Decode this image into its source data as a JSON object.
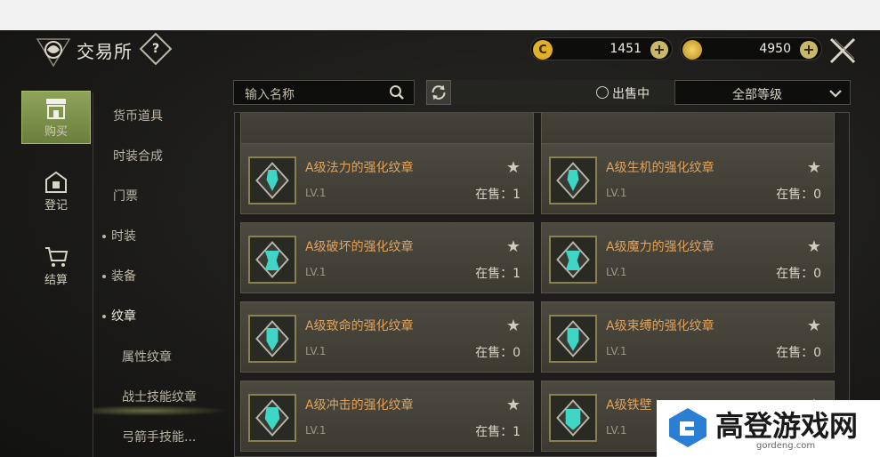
{
  "header": {
    "title": "交易所",
    "help": "?",
    "currencies": [
      {
        "icon": "c-coin-icon",
        "value": "1451"
      },
      {
        "icon": "gold-coin-icon",
        "value": "4950"
      }
    ],
    "plus": "+"
  },
  "leftnav": [
    {
      "label": "购买",
      "icon": "shop-icon",
      "active": true
    },
    {
      "label": "登记",
      "icon": "register-icon",
      "active": false
    },
    {
      "label": "结算",
      "icon": "cart-icon",
      "active": false
    }
  ],
  "sidenav": [
    {
      "label": "货币道具",
      "dot": false,
      "indent": false
    },
    {
      "label": "时装合成",
      "dot": false,
      "indent": false
    },
    {
      "label": "门票",
      "dot": false,
      "indent": false
    },
    {
      "label": "时装",
      "dot": true,
      "indent": false
    },
    {
      "label": "装备",
      "dot": true,
      "indent": false
    },
    {
      "label": "纹章",
      "dot": true,
      "indent": false,
      "selected": true
    },
    {
      "label": "属性纹章",
      "dot": false,
      "indent": true
    },
    {
      "label": "战士技能纹章",
      "dot": false,
      "indent": true
    },
    {
      "label": "弓箭手技能...",
      "dot": false,
      "indent": true
    }
  ],
  "toolbar": {
    "search_placeholder": "输入名称",
    "on_sale_label": "出售中",
    "grade_select": "全部等级"
  },
  "items": [
    {
      "name": "A级法力的强化纹章",
      "level": "LV.1",
      "stock": "在售：1"
    },
    {
      "name": "A级生机的强化纹章",
      "level": "LV.1",
      "stock": "在售：0"
    },
    {
      "name": "A级破坏的强化纹章",
      "level": "LV.1",
      "stock": "在售：1"
    },
    {
      "name": "A级魔力的强化纹章",
      "level": "LV.1",
      "stock": "在售：0"
    },
    {
      "name": "A级致命的强化纹章",
      "level": "LV.1",
      "stock": "在售：0"
    },
    {
      "name": "A级束缚的强化纹章",
      "level": "LV.1",
      "stock": "在售：0"
    },
    {
      "name": "A级冲击的强化纹章",
      "level": "LV.1",
      "stock": "在售：1"
    },
    {
      "name": "A级铁壁",
      "level": "LV.1",
      "stock": ""
    }
  ],
  "star": "★",
  "watermark": {
    "text": "高登游戏网",
    "url": "gordeng.com"
  },
  "colors": {
    "accent_green": "#8ea35a",
    "item_name": "#e2a25a",
    "emblem_teal": "#3fd6c6"
  }
}
